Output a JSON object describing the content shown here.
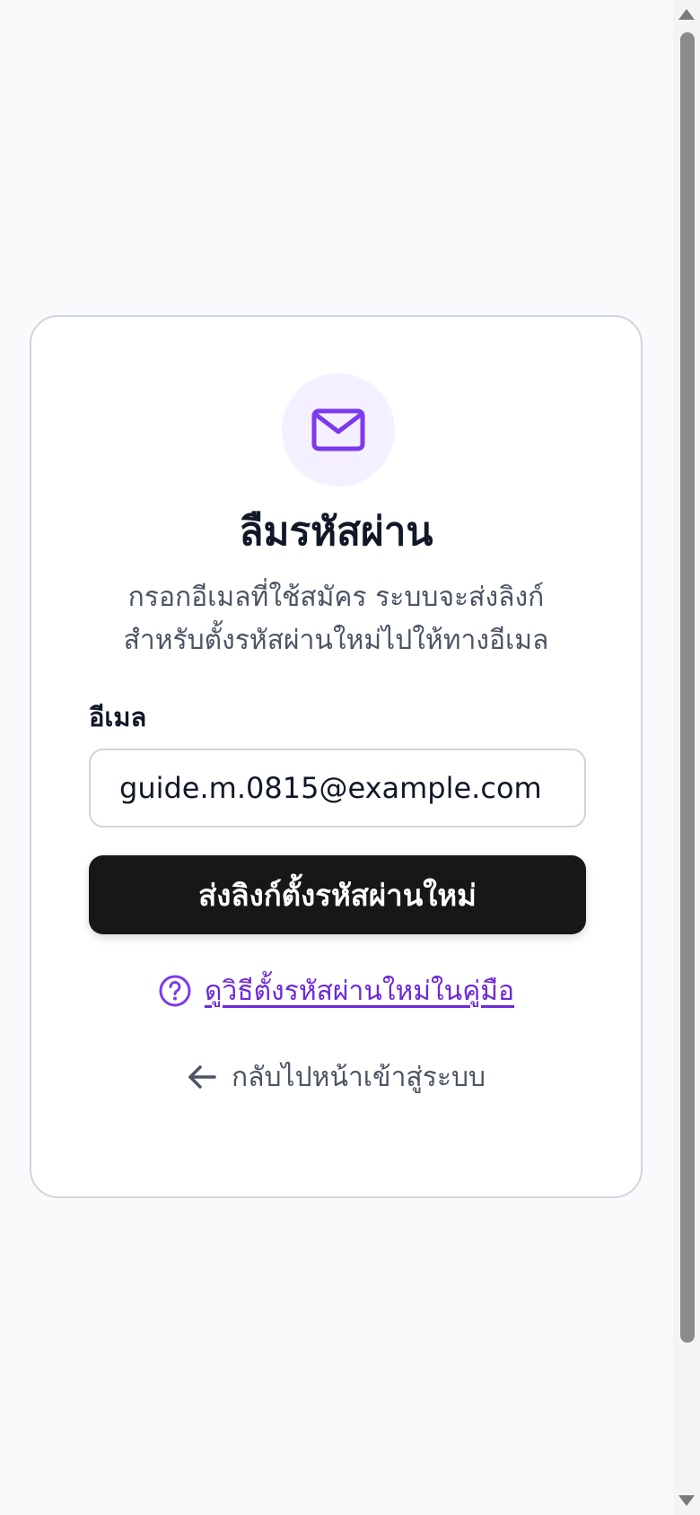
{
  "page": {
    "title": "ลืมรหัสผ่าน",
    "subtitle_line1": "กรอกอีเมลที่ใช้สมัคร ระบบจะส่งลิงก์",
    "subtitle_line2": "สำหรับตั้งรหัสผ่านใหม่ไปให้ทางอีเมล",
    "header_icon": "mail-icon"
  },
  "form": {
    "email_label": "อีเมล",
    "email_value": "guide.m.0815@example.com",
    "submit_label": "ส่งลิงก์ตั้งรหัสผ่านใหม่"
  },
  "links": {
    "help_label": "ดูวิธีตั้งรหัสผ่านใหม่ในคู่มือ",
    "help_icon": "help-circle-icon",
    "back_label": "กลับไปหน้าเข้าสู่ระบบ",
    "back_icon": "arrow-left-icon"
  },
  "colors": {
    "accent": "#7c3aed",
    "primary_button": "#171717",
    "icon_bg": "#f5f0ff"
  }
}
